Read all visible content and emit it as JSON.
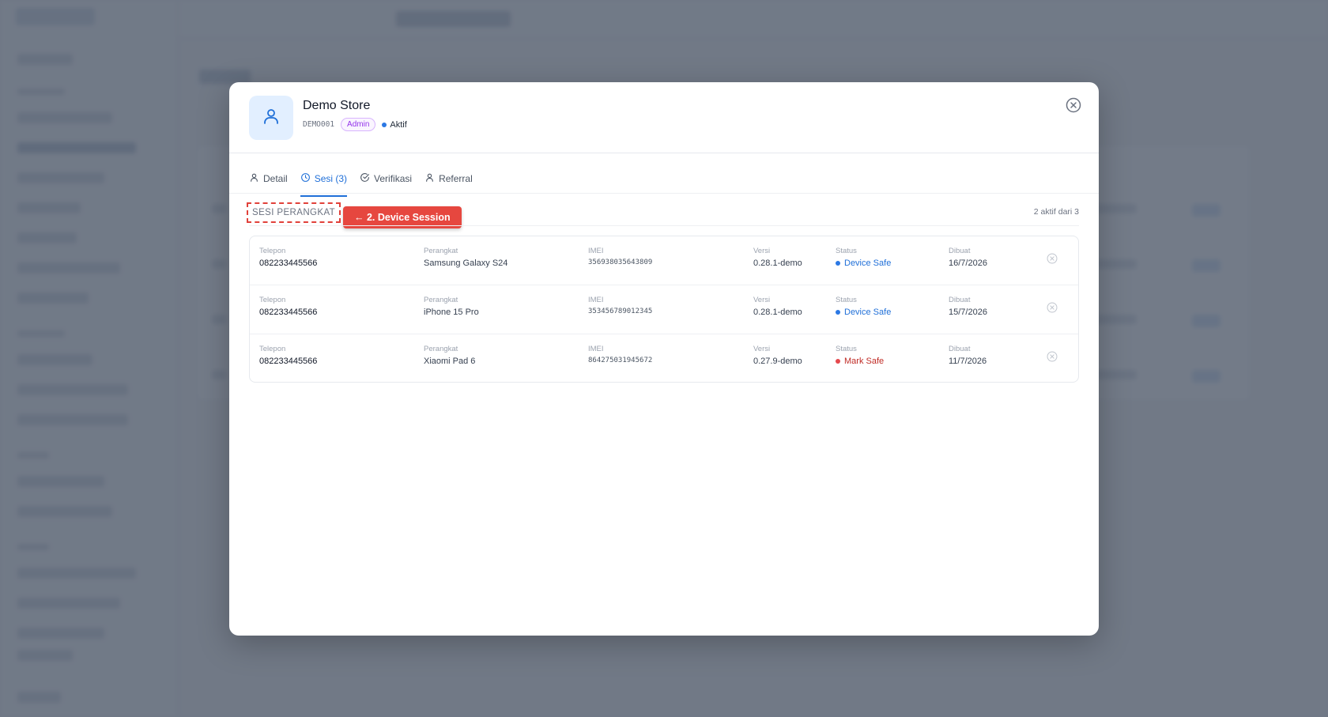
{
  "modal": {
    "store_name": "Demo Store",
    "store_code": "DEMO001",
    "role": "Admin",
    "status": "Aktif",
    "status_color": "#2b78e4"
  },
  "tabs": [
    {
      "label": "Detail",
      "icon": "user-icon",
      "active": false
    },
    {
      "label": "Sesi (3)",
      "icon": "clock-icon",
      "active": true
    },
    {
      "label": "Verifikasi",
      "icon": "check-circle-icon",
      "active": false
    },
    {
      "label": "Referral",
      "icon": "user-icon",
      "active": false
    }
  ],
  "section": {
    "title": "SESI PERANGKAT",
    "annotation": "← 2. Device Session",
    "count_text": "2 aktif dari 3"
  },
  "column_labels": {
    "phone": "Telepon",
    "device": "Perangkat",
    "imei": "IMEI",
    "version": "Versi",
    "status": "Status",
    "created": "Dibuat"
  },
  "sessions": [
    {
      "phone": "082233445566",
      "device": "Samsung Galaxy S24",
      "imei": "356938035643809",
      "version": "0.28.1-demo",
      "status": "Device Safe",
      "status_type": "safe",
      "created": "16/7/2026"
    },
    {
      "phone": "082233445566",
      "device": "iPhone 15 Pro",
      "imei": "353456789012345",
      "version": "0.28.1-demo",
      "status": "Device Safe",
      "status_type": "safe",
      "created": "15/7/2026"
    },
    {
      "phone": "082233445566",
      "device": "Xiaomi Pad 6",
      "imei": "864275031945672",
      "version": "0.27.9-demo",
      "status": "Mark Safe",
      "status_type": "mark",
      "created": "11/7/2026"
    }
  ],
  "colors": {
    "accent": "#1f6fd8",
    "annotation": "#e6473f",
    "safe": "#1f6fd8",
    "mark": "#c02b25"
  }
}
